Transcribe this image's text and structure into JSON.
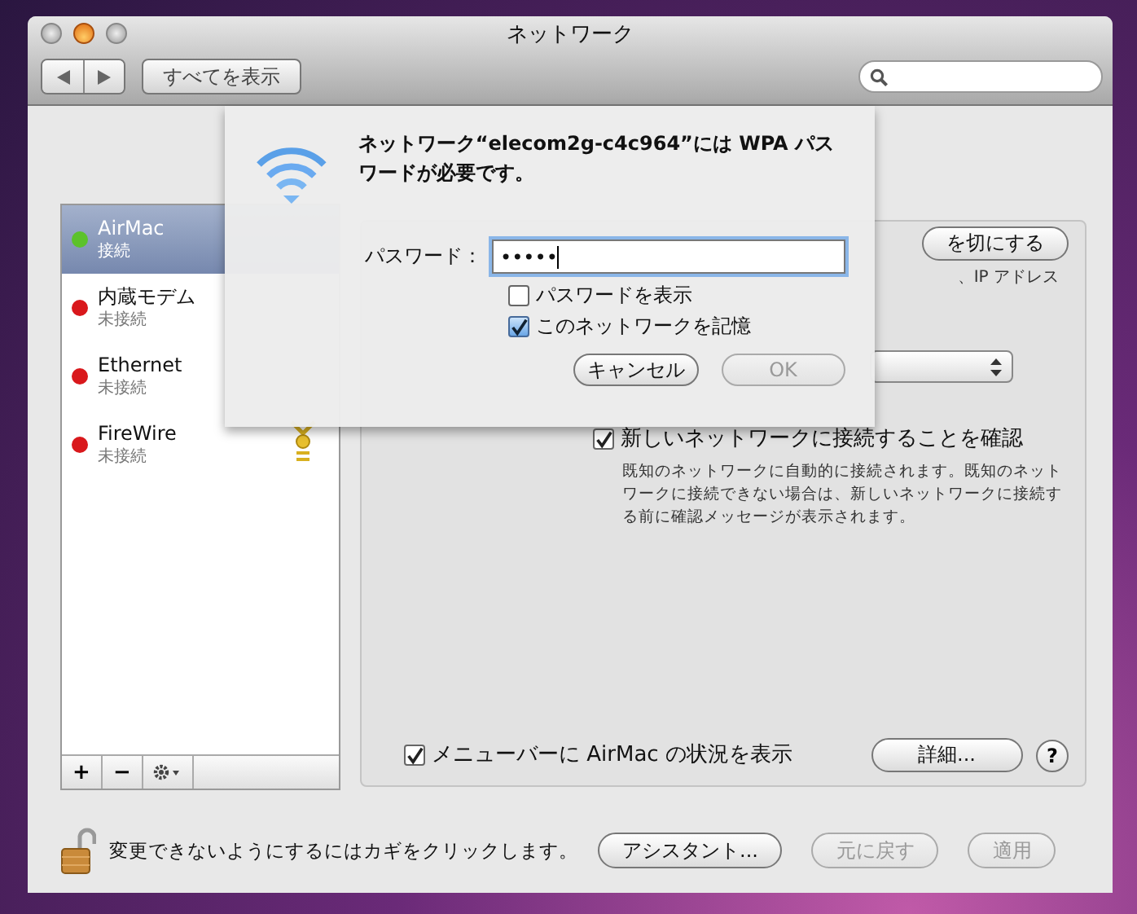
{
  "window": {
    "title": "ネットワーク"
  },
  "toolbar": {
    "show_all": "すべてを表示"
  },
  "services": [
    {
      "name": "AirMac",
      "status": "接続",
      "color": "#5cc22a",
      "selected": true
    },
    {
      "name": "内蔵モデム",
      "status": "未接続",
      "color": "#d9181c",
      "selected": false
    },
    {
      "name": "Ethernet",
      "status": "未接続",
      "color": "#d9181c",
      "selected": false
    },
    {
      "name": "FireWire",
      "status": "未接続",
      "color": "#d9181c",
      "selected": false
    }
  ],
  "service_actions": {
    "add": "+",
    "remove": "−"
  },
  "airmac_panel": {
    "power_button": "を切にする",
    "status_fragment": "、IP アドレス",
    "ask_new_networks": {
      "label": "新しいネットワークに接続することを確認",
      "checked": true
    },
    "ask_note": "既知のネットワークに自動的に接続されます。既知のネットワークに接続できない場合は、新しいネットワークに接続する前に確認メッセージが表示されます。",
    "show_in_menu_bar": {
      "label": "メニューバーに AirMac の状況を表示",
      "checked": true
    },
    "advanced_button": "詳細...",
    "help": "?"
  },
  "footer": {
    "lock_text": "変更できないようにするにはカギをクリックします。",
    "buttons": [
      {
        "label": "アシスタント...",
        "disabled": false
      },
      {
        "label": "元に戻す",
        "disabled": true
      },
      {
        "label": "適用",
        "disabled": true
      }
    ]
  },
  "sheet": {
    "message": "ネットワーク“elecom2g-c4c964”には WPA パスワードが必要です。",
    "password_label": "パスワード：",
    "password_value": "•••••",
    "options": [
      {
        "label": "パスワードを表示",
        "checked": false
      },
      {
        "label": "このネットワークを記憶",
        "checked": true
      }
    ],
    "buttons": [
      {
        "label": "キャンセル",
        "disabled": false
      },
      {
        "label": "OK",
        "disabled": true
      }
    ]
  }
}
